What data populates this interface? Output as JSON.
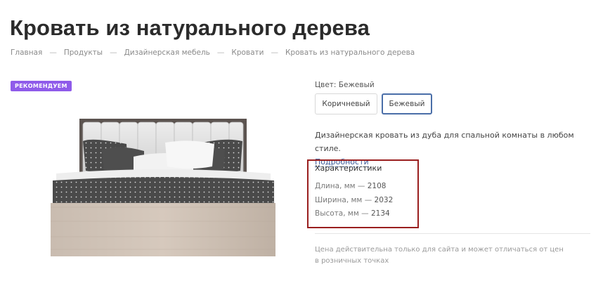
{
  "page": {
    "title": "Кровать из натурального дерева"
  },
  "breadcrumb": {
    "items": [
      "Главная",
      "Продукты",
      "Дизайнерская мебель",
      "Кровати"
    ],
    "current": "Кровать из натурального дерева",
    "separator": "—"
  },
  "badge": {
    "label": "РЕКОМЕНДУЕМ",
    "color": "#8f5bea"
  },
  "product": {
    "color_label": "Цвет: Бежевый",
    "color_options": [
      {
        "label": "Коричневый",
        "selected": false
      },
      {
        "label": "Бежевый",
        "selected": true
      }
    ],
    "description": "Дизайнерская кровать из дуба для спальной комнаты в любом стиле.",
    "more_link": "Подробности",
    "specs": {
      "title": "Характеристики",
      "rows": [
        {
          "label": "Длина, мм",
          "value": "2108"
        },
        {
          "label": "Ширина, мм",
          "value": "2032"
        },
        {
          "label": "Высота, мм",
          "value": "2134"
        }
      ]
    },
    "price_note": "Цена действительна только для сайта и может отличаться от цен в розничных точках"
  },
  "colors": {
    "accent": "#4a6ea8",
    "highlight_border": "#9a1f1f",
    "link": "#3d5a99"
  }
}
